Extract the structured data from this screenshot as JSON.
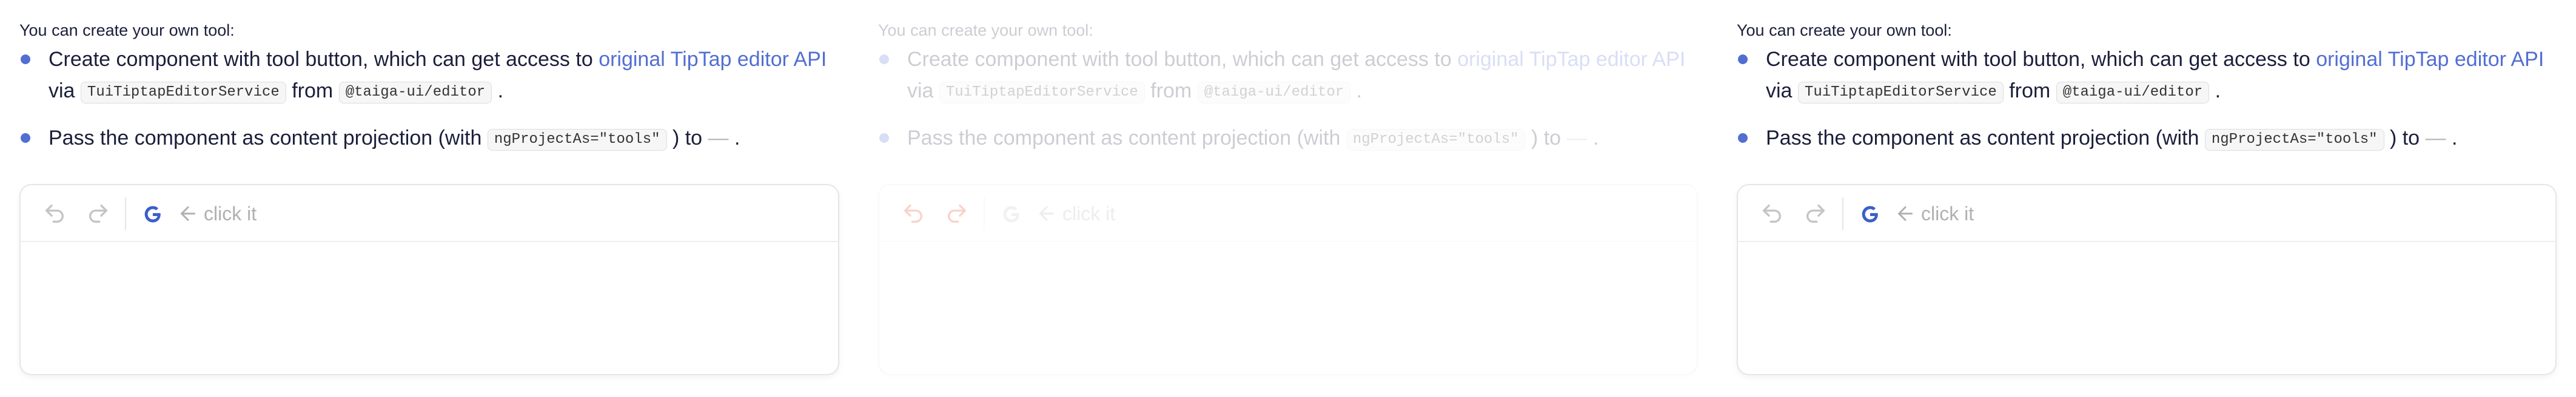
{
  "intro": "You can create your own tool:",
  "bullet1": {
    "text_before_link": "Create component with tool button, which can get access to ",
    "link": "original TipTap editor API",
    "via": "via",
    "service_code": "TuiTiptapEditorService",
    "from": "from",
    "package_code": "@taiga-ui/editor",
    "end": "."
  },
  "bullet2": {
    "text": "Pass the component as content projection (with",
    "code": "ngProjectAs=\"tools\"",
    "to": ") to",
    "dash": "—",
    "end": "."
  },
  "toolbar": {
    "hint": "click it",
    "undo_icon": "undo-icon",
    "redo_icon": "redo-icon",
    "tool_icon": "google-icon",
    "arrow_icon": "arrow-left-icon"
  },
  "colors": {
    "accent": "#526ed3",
    "history_active": "#e23a12",
    "history_inactive": "#c4c4c4",
    "hint": "#b0b0b0"
  },
  "panels": [
    {
      "name": "left",
      "state": "normal",
      "history": "inactive"
    },
    {
      "name": "middle",
      "state": "faded",
      "history": "active"
    },
    {
      "name": "right",
      "state": "normal",
      "history": "inactive"
    }
  ]
}
